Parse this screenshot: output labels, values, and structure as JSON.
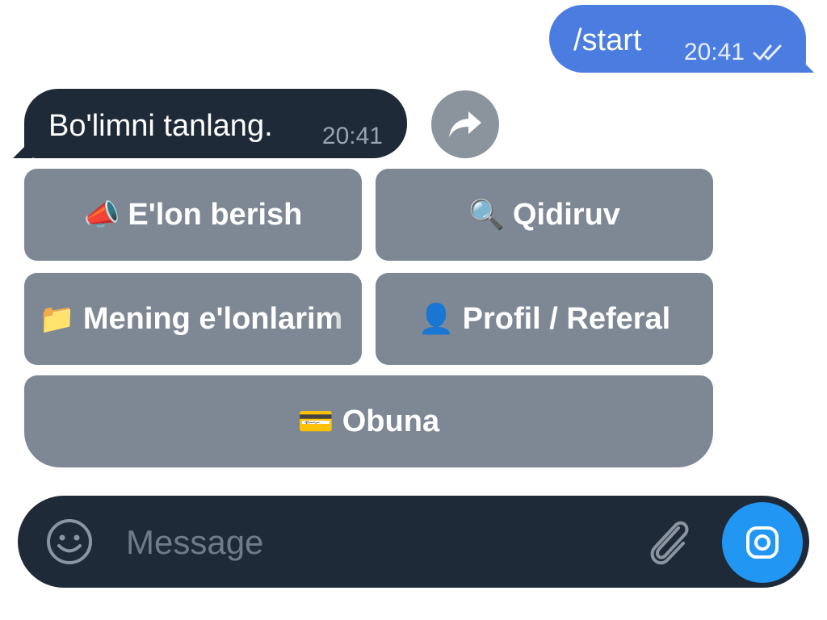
{
  "messages": {
    "outgoing": {
      "text": "/start",
      "time": "20:41",
      "status_icon": "double-check-icon"
    },
    "incoming": {
      "text": "Bo'limni tanlang.",
      "time": "20:41"
    }
  },
  "keyboard": {
    "elon": {
      "emoji": "📣",
      "label": "E'lon berish"
    },
    "qidir": {
      "emoji": "🔍",
      "label": "Qidiruv"
    },
    "mening": {
      "emoji": "📁",
      "label": "Mening e'lonlarim"
    },
    "profil": {
      "emoji": "👤",
      "label": "Profil / Referal"
    },
    "obuna": {
      "emoji": "💳",
      "label": "Obuna"
    }
  },
  "composer": {
    "placeholder": "Message"
  },
  "colors": {
    "outgoing_bubble": "#4a7ddf",
    "incoming_bubble": "#1f2a38",
    "keyboard_button": "#7e8894",
    "camera_button": "#2196f3"
  }
}
